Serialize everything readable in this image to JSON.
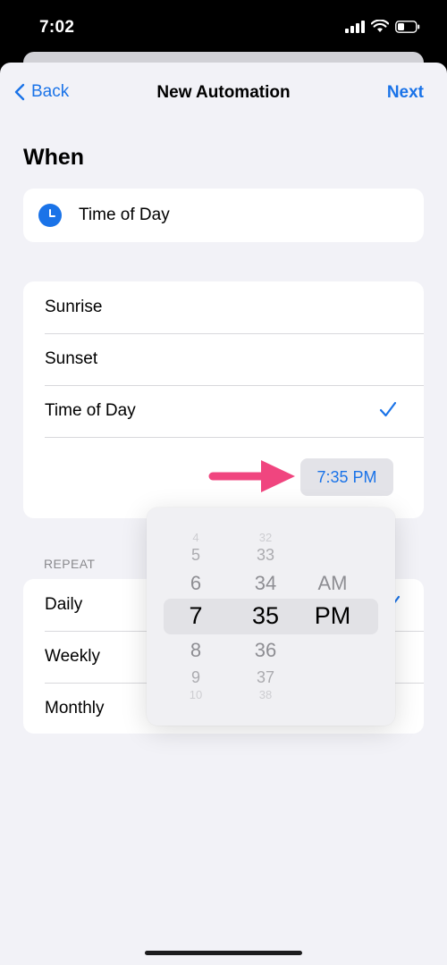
{
  "status_bar": {
    "time": "7:02",
    "icons": [
      "signal-icon",
      "wifi-icon",
      "battery-icon"
    ]
  },
  "nav": {
    "back_label": "Back",
    "title": "New Automation",
    "next_label": "Next"
  },
  "when": {
    "heading": "When",
    "trigger_icon": "clock-icon",
    "trigger_label": "Time of Day"
  },
  "options": {
    "items": [
      {
        "label": "Sunrise",
        "selected": false
      },
      {
        "label": "Sunset",
        "selected": false
      },
      {
        "label": "Time of Day",
        "selected": true
      }
    ],
    "time_value": "7:35 PM"
  },
  "repeat": {
    "heading": "REPEAT",
    "items": [
      {
        "label": "Daily",
        "selected": true
      },
      {
        "label": "Weekly",
        "selected": false
      },
      {
        "label": "Monthly",
        "selected": false
      }
    ]
  },
  "picker": {
    "hours": [
      "4",
      "5",
      "6",
      "7",
      "8",
      "9",
      "10"
    ],
    "minutes": [
      "32",
      "33",
      "34",
      "35",
      "36",
      "37",
      "38"
    ],
    "periods": [
      "AM",
      "PM"
    ],
    "selected_hour": "7",
    "selected_minute": "35",
    "selected_period": "PM"
  },
  "colors": {
    "accent": "#1a73e8",
    "arrow": "#f0457f",
    "background": "#f2f2f7"
  }
}
